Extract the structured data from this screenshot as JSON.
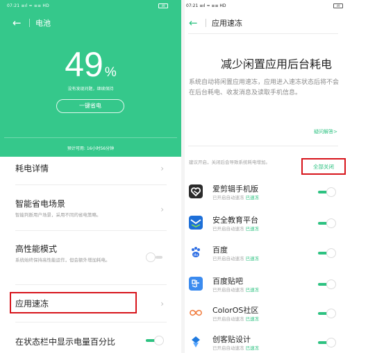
{
  "status_bar": {
    "time": "07:21",
    "signal": "≡ıl ≈ ≡≡ HD",
    "battery": "49"
  },
  "left": {
    "nav": {
      "back_icon": "back-arrow-icon",
      "title": "电池"
    },
    "hero": {
      "percent": "49",
      "unit": "%",
      "status": "没有发现问题，继续保持",
      "save_button": "一键省电",
      "estimate": "预计可用: 16小时56分钟"
    },
    "items": [
      {
        "title": "耗电详情",
        "subtitle": ""
      },
      {
        "title": "智能省电场景",
        "subtitle": "智能判断用户场景，采用不同的省电策略。"
      },
      {
        "title": "高性能模式",
        "subtitle": "系统始终保持高性能运作，但会额外增加耗电。",
        "toggle": "off"
      },
      {
        "title": "应用速冻",
        "subtitle": ""
      },
      {
        "title": "在状态栏中显示电量百分比",
        "subtitle": "",
        "toggle": "on"
      }
    ]
  },
  "right": {
    "nav": {
      "back_icon": "back-arrow-icon",
      "title": "应用速冻"
    },
    "headline": "减少闲置应用后台耗电",
    "description": "系统自动将闲置应用速冻，应用进入速冻状态后将不会在后台耗电、收发消息及读取手机信息。",
    "faq_link": "疑问解答>",
    "hint": "建议开启，关闭后会导致系统耗电增加。",
    "close_all": "全部关闭",
    "status_prefix": "已开启自动速冻",
    "status_suffix": "已速冻",
    "apps": [
      {
        "name": "爱剪辑手机版",
        "icon": "heart-clip-icon",
        "color": "#2b2b2b",
        "toggle": "on"
      },
      {
        "name": "安全教育平台",
        "icon": "education-icon",
        "color": "#1d6fd8",
        "toggle": "on"
      },
      {
        "name": "百度",
        "icon": "baidu-paw-icon",
        "color": "#2f6fe4",
        "toggle": "on"
      },
      {
        "name": "百度贴吧",
        "icon": "tieba-icon",
        "color": "#3b8bef",
        "toggle": "on"
      },
      {
        "name": "ColorOS社区",
        "icon": "infinity-icon",
        "color": "#f07a3b",
        "toggle": "on"
      },
      {
        "name": "创客贴设计",
        "icon": "ck-icon",
        "color": "#1f7ae0",
        "toggle": "on"
      }
    ]
  },
  "colors": {
    "accent": "#2dc281",
    "hero": "#35c88b",
    "highlight": "#d7131a"
  }
}
